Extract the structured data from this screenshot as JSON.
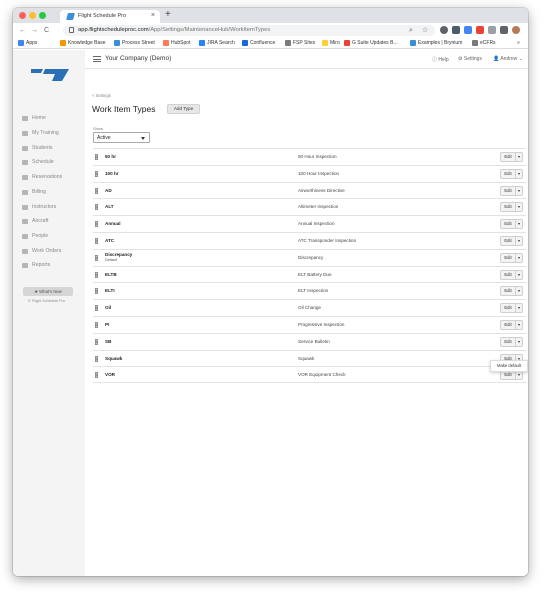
{
  "browser": {
    "tab_title": "Flight Schedule Pro",
    "tab_close": "×",
    "new_tab": "+",
    "url_host": "app.flightscheduleproc.com",
    "url_path": "/App/Settings/MaintenanceHub/WorkItemTypes",
    "nav": {
      "back": "←",
      "forward": "→",
      "reload": "C"
    },
    "bookmarks": [
      "Apps",
      "Knowledge Base",
      "Process Street",
      "HubSpot",
      "JIRA Search",
      "Confluence",
      "FSP Sites",
      "Miro",
      "G Suite Updates B...",
      "Examples | Brynium",
      "eCFRs"
    ],
    "bookmarks_more": "»"
  },
  "header": {
    "company": "Your Company (Demo)",
    "help": "Help",
    "settings": "Settings",
    "user": "Andrew"
  },
  "sidebar": {
    "items": [
      "Home",
      "My Training",
      "Students",
      "Schedule",
      "Reservations",
      "Billing",
      "Instructors",
      "Aircraft",
      "People",
      "Work Orders",
      "Reports"
    ],
    "whats_new": "★ What's New",
    "copyright": "© Flight Schedule Pro"
  },
  "page": {
    "back_link": "< Settings",
    "title": "Work Item Types",
    "add_button": "Add Type",
    "show_label": "Show",
    "show_value": "Active"
  },
  "rows": [
    {
      "code": "50 hr",
      "sub": "",
      "desc": "50 Hour Inspection"
    },
    {
      "code": "100 hr",
      "sub": "",
      "desc": "100 Hour Inspection"
    },
    {
      "code": "AD",
      "sub": "",
      "desc": "Airworthiness Directive"
    },
    {
      "code": "ALT",
      "sub": "",
      "desc": "Altimeter Inspection"
    },
    {
      "code": "Annual",
      "sub": "",
      "desc": "Annual Inspection"
    },
    {
      "code": "ATC",
      "sub": "",
      "desc": "ATC Transponder Inspection"
    },
    {
      "code": "Discrepancy",
      "sub": "Default",
      "desc": "Discrepancy"
    },
    {
      "code": "ELTB",
      "sub": "",
      "desc": "ELT Battery Due"
    },
    {
      "code": "ELTI",
      "sub": "",
      "desc": "ELT Inspection"
    },
    {
      "code": "Oil",
      "sub": "",
      "desc": "Oil Change"
    },
    {
      "code": "PI",
      "sub": "",
      "desc": "Progressive Inspection"
    },
    {
      "code": "SB",
      "sub": "",
      "desc": "Service Bulletin"
    },
    {
      "code": "Squawk",
      "sub": "",
      "desc": "Squawk"
    },
    {
      "code": "VOR",
      "sub": "",
      "desc": "VOR Equipment Check"
    }
  ],
  "row_action": "Edit",
  "dropdown_menu": {
    "item": "Make default"
  },
  "colors": {
    "accent": "#2b6fb6",
    "close": "#ff5f57",
    "minimize": "#febc2e",
    "maximize": "#28c840",
    "sidebar_bg": "#f4f4f4"
  }
}
